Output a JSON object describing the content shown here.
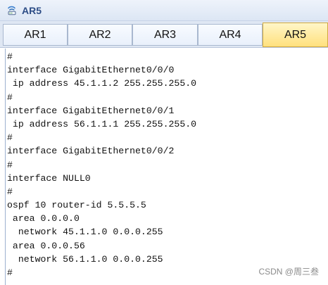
{
  "window": {
    "title": "AR5",
    "icon": "router-icon"
  },
  "tabs": [
    {
      "label": "AR1",
      "active": false
    },
    {
      "label": "AR2",
      "active": false
    },
    {
      "label": "AR3",
      "active": false
    },
    {
      "label": "AR4",
      "active": false
    },
    {
      "label": "AR5",
      "active": true
    }
  ],
  "console": {
    "lines": [
      "#",
      "interface GigabitEthernet0/0/0",
      " ip address 45.1.1.2 255.255.255.0",
      "#",
      "interface GigabitEthernet0/0/1",
      " ip address 56.1.1.1 255.255.255.0",
      "#",
      "interface GigabitEthernet0/0/2",
      "#",
      "interface NULL0",
      "#",
      "ospf 10 router-id 5.5.5.5",
      " area 0.0.0.0",
      "  network 45.1.1.0 0.0.0.255",
      " area 0.0.0.56",
      "  network 56.1.1.0 0.0.0.255",
      "#"
    ]
  },
  "watermark": "CSDN @周三叁",
  "colors": {
    "title_text": "#2d4d86",
    "active_tab": "#ffe07d",
    "tab_background": "#e9f0fb"
  }
}
